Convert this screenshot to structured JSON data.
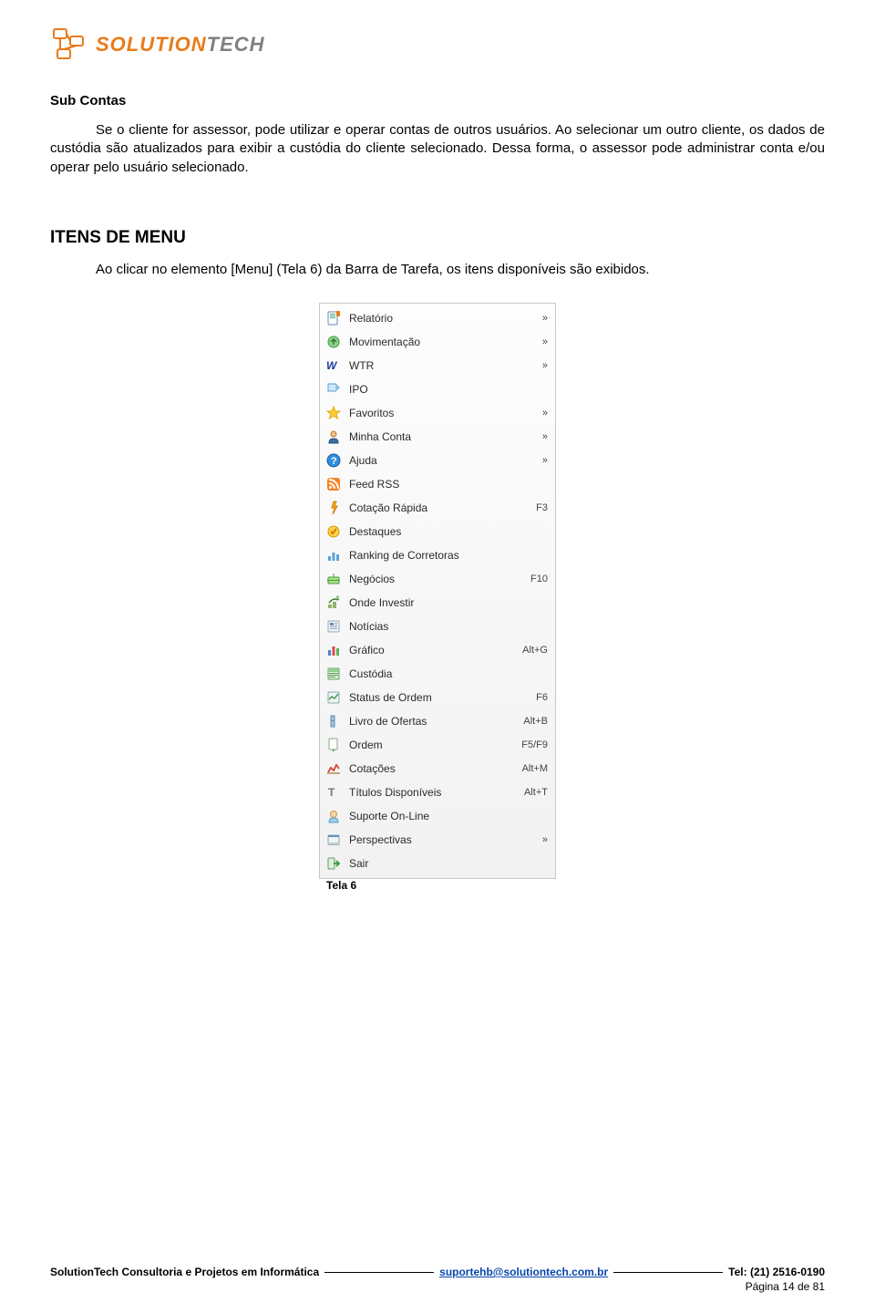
{
  "logo": {
    "part1": "SOLUTION",
    "part2": "TECH"
  },
  "section1": {
    "heading": "Sub Contas",
    "paragraph": "Se o cliente for assessor, pode utilizar e operar contas de outros usuários. Ao selecionar um outro cliente, os dados de custódia são atualizados para exibir a custódia do cliente selecionado. Dessa forma, o assessor pode administrar conta e/ou operar pelo usuário selecionado."
  },
  "section2": {
    "heading": "ITENS DE MENU",
    "paragraph": "Ao clicar no elemento [Menu] (Tela 6) da Barra de Tarefa, os itens disponíveis são exibidos."
  },
  "menu": {
    "items": [
      {
        "label": "Relatório",
        "shortcut": "»",
        "icon": "report-icon"
      },
      {
        "label": "Movimentação",
        "shortcut": "»",
        "icon": "movement-icon"
      },
      {
        "label": "WTR",
        "shortcut": "»",
        "icon": "wtr-icon"
      },
      {
        "label": "IPO",
        "shortcut": "",
        "icon": "ipo-tag-icon"
      },
      {
        "label": "Favoritos",
        "shortcut": "»",
        "icon": "star-icon"
      },
      {
        "label": "Minha Conta",
        "shortcut": "»",
        "icon": "user-account-icon"
      },
      {
        "label": "Ajuda",
        "shortcut": "»",
        "icon": "help-icon"
      },
      {
        "label": "Feed RSS",
        "shortcut": "",
        "icon": "rss-icon"
      },
      {
        "label": "Cotação Rápida",
        "shortcut": "F3",
        "icon": "quick-quote-icon"
      },
      {
        "label": "Destaques",
        "shortcut": "",
        "icon": "highlights-icon"
      },
      {
        "label": "Ranking de Corretoras",
        "shortcut": "",
        "icon": "ranking-icon"
      },
      {
        "label": "Negócios",
        "shortcut": "F10",
        "icon": "business-icon"
      },
      {
        "label": "Onde Investir",
        "shortcut": "",
        "icon": "invest-icon"
      },
      {
        "label": "Notícias",
        "shortcut": "",
        "icon": "news-icon"
      },
      {
        "label": "Gráfico",
        "shortcut": "Alt+G",
        "icon": "chart-icon"
      },
      {
        "label": "Custódia",
        "shortcut": "",
        "icon": "custody-icon"
      },
      {
        "label": "Status de Ordem",
        "shortcut": "F6",
        "icon": "order-status-icon"
      },
      {
        "label": "Livro de Ofertas",
        "shortcut": "Alt+B",
        "icon": "order-book-icon"
      },
      {
        "label": "Ordem",
        "shortcut": "F5/F9",
        "icon": "order-icon"
      },
      {
        "label": "Cotações",
        "shortcut": "Alt+M",
        "icon": "quotes-icon"
      },
      {
        "label": "Títulos Disponíveis",
        "shortcut": "Alt+T",
        "icon": "available-titles-icon"
      },
      {
        "label": "Suporte On-Line",
        "shortcut": "",
        "icon": "support-icon"
      },
      {
        "label": "Perspectivas",
        "shortcut": "»",
        "icon": "perspectives-icon"
      },
      {
        "label": "Sair",
        "shortcut": "",
        "icon": "exit-icon"
      }
    ]
  },
  "caption": "Tela  6",
  "footer": {
    "company": "SolutionTech Consultoria e Projetos em Informática",
    "email": "suportehb@solutiontech.com.br",
    "phone": "Tel: (21) 2516-0190",
    "page": "Página 14 de 81"
  }
}
